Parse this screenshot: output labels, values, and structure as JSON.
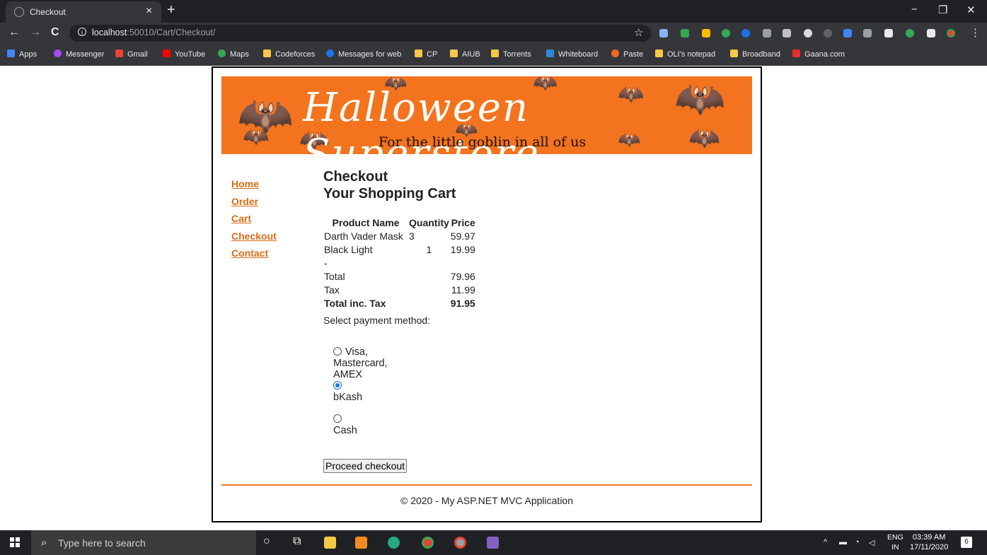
{
  "browser": {
    "tab_title": "Checkout",
    "tab_close": "×",
    "new_tab": "+",
    "url_host": "localhost",
    "url_path": ":50010/Cart/Checkout/",
    "nav": {
      "back": "←",
      "forward": "→",
      "reload": "C"
    },
    "window_controls": {
      "minimize": "−",
      "maximize": "❐",
      "close": "✕"
    },
    "bookmarks": [
      {
        "label": "Apps",
        "icon": "apps-grid-icon",
        "color": "#4285f4"
      },
      {
        "label": "Messenger",
        "icon": "messenger-icon",
        "color": "#a24bf5"
      },
      {
        "label": "Gmail",
        "icon": "gmail-icon",
        "color": "#ea4335"
      },
      {
        "label": "YouTube",
        "icon": "youtube-icon",
        "color": "#ff0000"
      },
      {
        "label": "Maps",
        "icon": "maps-icon",
        "color": "#34a853"
      },
      {
        "label": "Codeforces",
        "icon": "folder-icon",
        "color": "#f6c84a"
      },
      {
        "label": "Messages for web",
        "icon": "messages-icon",
        "color": "#1a73e8"
      },
      {
        "label": "CP",
        "icon": "folder-icon",
        "color": "#f6c84a"
      },
      {
        "label": "AIUB",
        "icon": "folder-icon",
        "color": "#f6c84a"
      },
      {
        "label": "Torrents",
        "icon": "folder-icon",
        "color": "#f6c84a"
      },
      {
        "label": "Whiteboard",
        "icon": "whiteboard-icon",
        "color": "#2b88d8"
      },
      {
        "label": "Paste",
        "icon": "paste-icon",
        "color": "#f26b24"
      },
      {
        "label": "OLI's notepad",
        "icon": "folder-icon",
        "color": "#f6c84a"
      },
      {
        "label": "Broadband",
        "icon": "folder-icon",
        "color": "#f6c84a"
      },
      {
        "label": "Gaana.com",
        "icon": "gaana-icon",
        "color": "#e72c30"
      }
    ]
  },
  "banner": {
    "title": "Halloween Superstore",
    "subtitle": "For the little goblin in all of us",
    "color": "#f3731e"
  },
  "nav_links": [
    "Home",
    "Order",
    "Cart",
    "Checkout",
    "Contact"
  ],
  "checkout": {
    "heading": "Checkout",
    "subheading": "Your Shopping Cart",
    "columns": [
      "Product Name",
      "Quantity",
      "Price"
    ],
    "items": [
      {
        "name": "Darth Vader Mask",
        "qty": "3",
        "price": "59.97"
      },
      {
        "name": "Black Light",
        "qty": "1",
        "price": "19.99"
      }
    ],
    "separator": "-",
    "total_label": "Total",
    "total": "79.96",
    "tax_label": "Tax",
    "tax": "11.99",
    "grand_label": "Total inc. Tax",
    "grand_total": "91.95",
    "payment_label": "Select payment method:",
    "payment_options": [
      {
        "label": "Visa, Mastercard, AMEX",
        "selected": false
      },
      {
        "label": "bKash",
        "selected": true
      },
      {
        "label": "Cash",
        "selected": false
      }
    ],
    "proceed_label": "Proceed checkout"
  },
  "footer": "© 2020 - My ASP.NET MVC Application",
  "taskbar": {
    "search_placeholder": "Type here to search",
    "lang_top": "ENG",
    "lang_bottom": "IN",
    "time": "03:39 AM",
    "date": "17/11/2020",
    "notifications": "6"
  }
}
